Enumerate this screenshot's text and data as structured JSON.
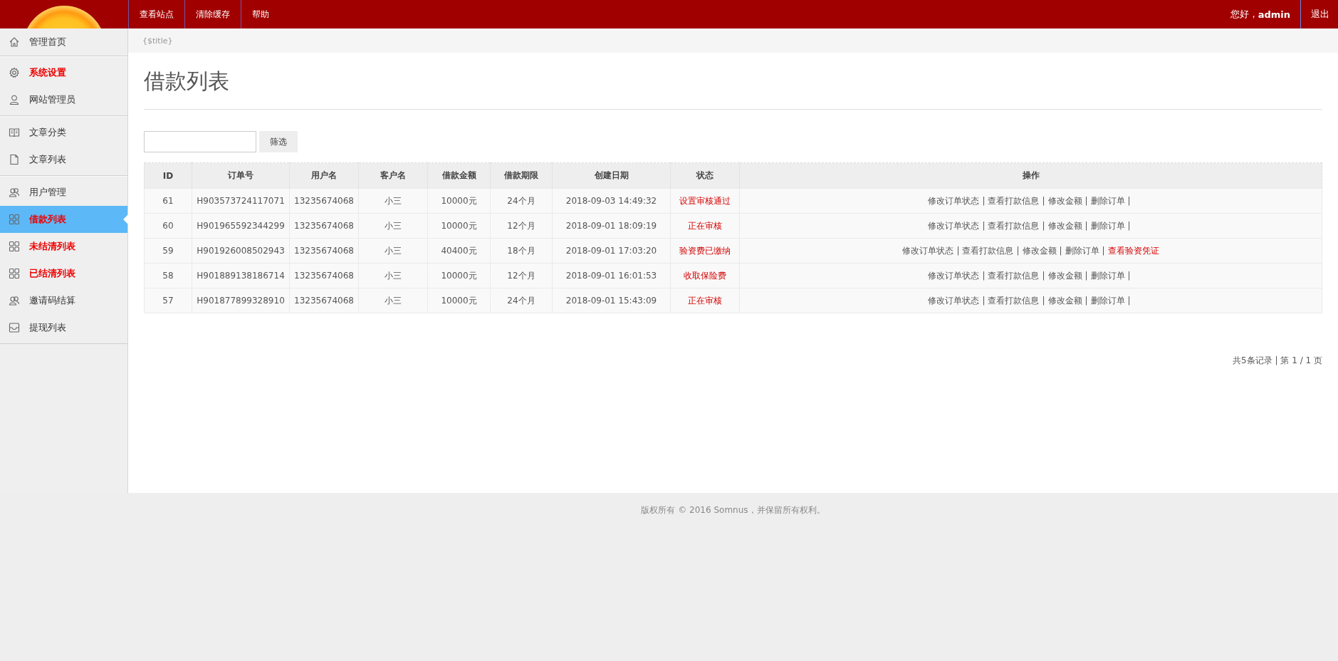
{
  "header": {
    "nav": [
      "查看站点",
      "清除缓存",
      "帮助"
    ],
    "greeting": "您好，",
    "user": "admin",
    "logout": "退出"
  },
  "sidebar": {
    "groups": [
      {
        "items": [
          {
            "label": "管理首页",
            "highlight": false,
            "selected": false
          }
        ]
      },
      {
        "items": [
          {
            "label": "系统设置",
            "highlight": true,
            "selected": false
          },
          {
            "label": "网站管理员",
            "highlight": false,
            "selected": false
          }
        ]
      },
      {
        "items": [
          {
            "label": "文章分类",
            "highlight": false,
            "selected": false
          },
          {
            "label": "文章列表",
            "highlight": false,
            "selected": false
          }
        ]
      },
      {
        "items": [
          {
            "label": "用户管理",
            "highlight": false,
            "selected": false
          },
          {
            "label": "借款列表",
            "highlight": true,
            "selected": true
          },
          {
            "label": "未结清列表",
            "highlight": true,
            "selected": false
          },
          {
            "label": "已结清列表",
            "highlight": true,
            "selected": false
          },
          {
            "label": "邀请码结算",
            "highlight": false,
            "selected": false
          },
          {
            "label": "提现列表",
            "highlight": false,
            "selected": false
          }
        ]
      }
    ]
  },
  "breadcrumb": "{$title}",
  "page_title": "借款列表",
  "filter": {
    "button": "筛选"
  },
  "table": {
    "columns": [
      "ID",
      "订单号",
      "用户名",
      "客户名",
      "借款金额",
      "借款期限",
      "创建日期",
      "状态",
      "操作"
    ],
    "rows": [
      {
        "cells": [
          "61",
          "H903573724117071",
          "13235674068",
          "小三",
          "10000元",
          "24个月",
          "2018-09-03 14:49:32"
        ],
        "status": "设置审核通过",
        "actions": [
          {
            "text": "修改订单状态",
            "sep": "|",
            "highlight": false
          },
          {
            "text": "查看打款信息",
            "sep": "|",
            "highlight": false
          },
          {
            "text": "修改金额",
            "sep": "|",
            "highlight": false
          },
          {
            "text": "删除订单",
            "sep": "|",
            "highlight": false
          }
        ]
      },
      {
        "cells": [
          "60",
          "H901965592344299",
          "13235674068",
          "小三",
          "10000元",
          "12个月",
          "2018-09-01 18:09:19"
        ],
        "status": "正在审核",
        "actions": [
          {
            "text": "修改订单状态",
            "sep": "|",
            "highlight": false
          },
          {
            "text": "查看打款信息",
            "sep": "|",
            "highlight": false
          },
          {
            "text": "修改金额",
            "sep": "|",
            "highlight": false
          },
          {
            "text": "删除订单",
            "sep": "|",
            "highlight": false
          }
        ]
      },
      {
        "cells": [
          "59",
          "H901926008502943",
          "13235674068",
          "小三",
          "40400元",
          "18个月",
          "2018-09-01 17:03:20"
        ],
        "status": "验资费已缴纳",
        "actions": [
          {
            "text": "修改订单状态",
            "sep": "|",
            "highlight": false
          },
          {
            "text": "查看打款信息",
            "sep": "|",
            "highlight": false
          },
          {
            "text": "修改金额",
            "sep": "|",
            "highlight": false
          },
          {
            "text": "删除订单",
            "sep": "|",
            "highlight": false
          },
          {
            "text": "查看验资凭证",
            "highlight": true
          }
        ]
      },
      {
        "cells": [
          "58",
          "H901889138186714",
          "13235674068",
          "小三",
          "10000元",
          "12个月",
          "2018-09-01 16:01:53"
        ],
        "status": "收取保险费",
        "actions": [
          {
            "text": "修改订单状态",
            "sep": "|",
            "highlight": false
          },
          {
            "text": "查看打款信息",
            "sep": "|",
            "highlight": false
          },
          {
            "text": "修改金额",
            "sep": "|",
            "highlight": false
          },
          {
            "text": "删除订单",
            "sep": "|",
            "highlight": false
          }
        ]
      },
      {
        "cells": [
          "57",
          "H901877899328910",
          "13235674068",
          "小三",
          "10000元",
          "24个月",
          "2018-09-01 15:43:09"
        ],
        "status": "正在审核",
        "actions": [
          {
            "text": "修改订单状态",
            "sep": "|",
            "highlight": false
          },
          {
            "text": "查看打款信息",
            "sep": "|",
            "highlight": false
          },
          {
            "text": "修改金额",
            "sep": "|",
            "highlight": false
          },
          {
            "text": "删除订单",
            "sep": "|",
            "highlight": false
          }
        ]
      }
    ]
  },
  "pagination": "共5条记录 | 第 1 / 1 页",
  "footer": "版权所有 © 2016 Somnus，并保留所有权利。"
}
